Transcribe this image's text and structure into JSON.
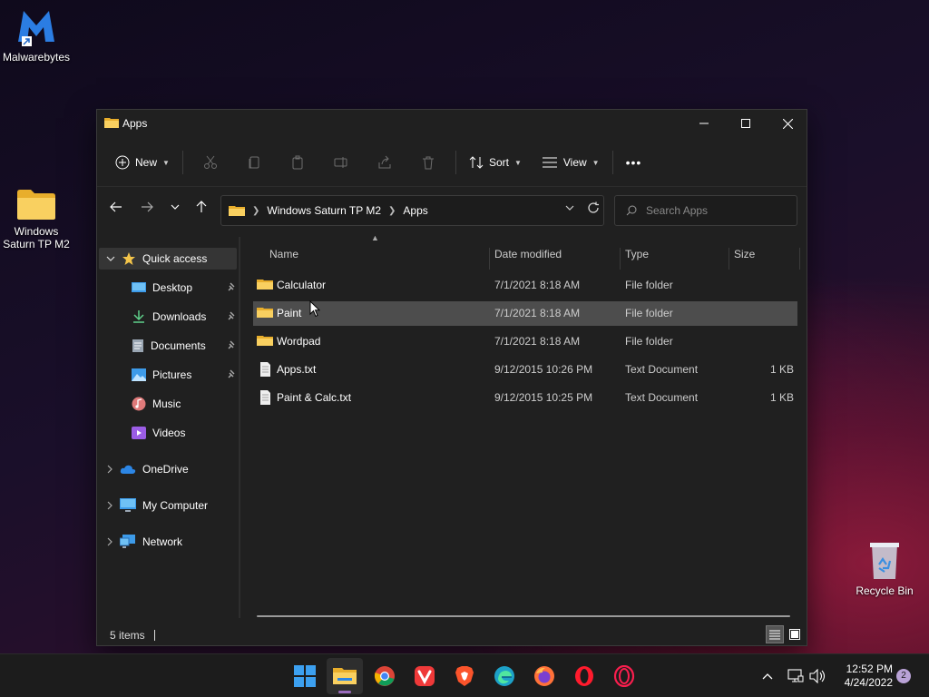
{
  "desktop": {
    "icons": [
      {
        "label": "Malwarebytes"
      },
      {
        "label": "Windows Saturn TP M2"
      },
      {
        "label": "Recycle Bin"
      }
    ]
  },
  "window": {
    "title": "Apps",
    "toolbar": {
      "new_label": "New",
      "sort_label": "Sort",
      "view_label": "View",
      "more_label": "•••"
    },
    "address": {
      "segments": [
        "Windows Saturn TP M2",
        "Apps"
      ]
    },
    "search": {
      "placeholder": "Search Apps"
    },
    "sidebar": {
      "quick_access": "Quick access",
      "items": [
        {
          "label": "Desktop",
          "pinned": true
        },
        {
          "label": "Downloads",
          "pinned": true
        },
        {
          "label": "Documents",
          "pinned": true
        },
        {
          "label": "Pictures",
          "pinned": true
        },
        {
          "label": "Music",
          "pinned": false
        },
        {
          "label": "Videos",
          "pinned": false
        }
      ],
      "roots": [
        {
          "label": "OneDrive"
        },
        {
          "label": "My Computer"
        },
        {
          "label": "Network"
        }
      ]
    },
    "columns": {
      "name": "Name",
      "date": "Date modified",
      "type": "Type",
      "size": "Size"
    },
    "files": [
      {
        "name": "Calculator",
        "date": "7/1/2021 8:18 AM",
        "type": "File folder",
        "size": "",
        "kind": "folder"
      },
      {
        "name": "Paint",
        "date": "7/1/2021 8:18 AM",
        "type": "File folder",
        "size": "",
        "kind": "folder",
        "selected": true
      },
      {
        "name": "Wordpad",
        "date": "7/1/2021 8:18 AM",
        "type": "File folder",
        "size": "",
        "kind": "folder"
      },
      {
        "name": "Apps.txt",
        "date": "9/12/2015 10:26 PM",
        "type": "Text Document",
        "size": "1 KB",
        "kind": "text"
      },
      {
        "name": "Paint & Calc.txt",
        "date": "9/12/2015 10:25 PM",
        "type": "Text Document",
        "size": "1 KB",
        "kind": "text"
      }
    ],
    "status": {
      "count": "5 items"
    }
  },
  "taskbar": {
    "clock": {
      "time": "12:52 PM",
      "date": "4/24/2022"
    },
    "notification_count": "2"
  },
  "colors": {
    "folder": "#f4c54a",
    "accent": "#9a6bbd",
    "window_bg": "#202020",
    "selection": "#4d4d4d"
  }
}
